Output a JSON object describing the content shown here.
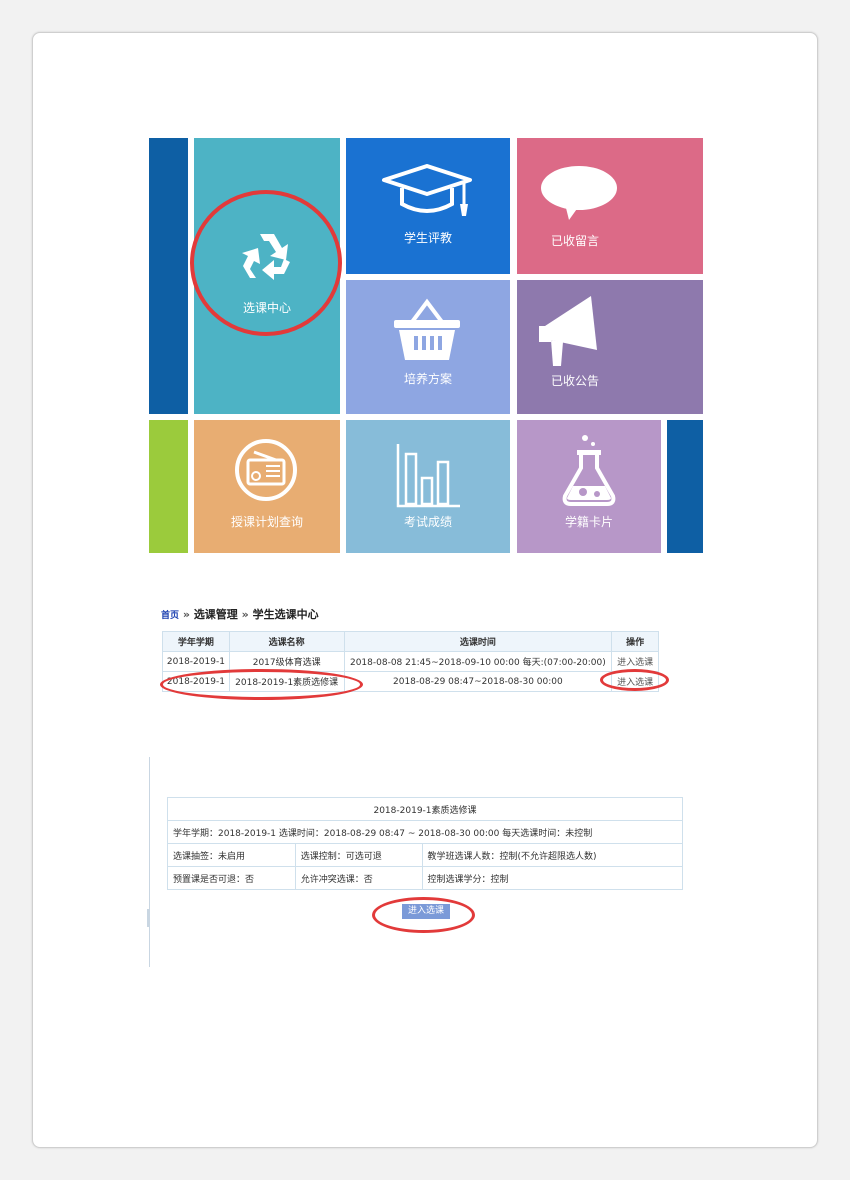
{
  "tiles": {
    "course_selection": "选课中心",
    "student_evaluation": "学生评教",
    "received_messages": "已收留言",
    "training_plan": "培养方案",
    "received_notices": "已收公告",
    "teaching_plan_query": "授课计划查询",
    "exam_scores": "考试成绩",
    "student_card": "学籍卡片"
  },
  "colors": {
    "dark_blue": "#0e5fa4",
    "teal": "#4db3c5",
    "blue": "#1a72d2",
    "pink": "#dc6a87",
    "periwinkle": "#8ea6e2",
    "purple": "#8e79ad",
    "green": "#9bcb3c",
    "orange": "#e8ad72",
    "light_blue": "#87bcd9",
    "lavender": "#b797c8",
    "annotation_red": "#e23a3a"
  },
  "breadcrumb": {
    "home": "首页",
    "separator": "»",
    "level1": "选课管理",
    "level2": "学生选课中心"
  },
  "course_table": {
    "headers": [
      "学年学期",
      "选课名称",
      "选课时间",
      "操作"
    ],
    "rows": [
      {
        "term": "2018-2019-1",
        "name": "2017级体育选课",
        "time": "2018-08-08 21:45~2018-09-10 00:00   每天:(07:00-20:00)",
        "action": "进入选课"
      },
      {
        "term": "2018-2019-1",
        "name": "2018-2019-1素质选修课",
        "time": "2018-08-29 08:47~2018-08-30 00:00",
        "action": "进入选课"
      }
    ]
  },
  "detail": {
    "title": "2018-2019-1素质选修课",
    "term_line": "学年学期：2018-2019-1      选课时间：2018-08-29 08:47 ~ 2018-08-30 00:00      每天选课时间：未控制",
    "r2c1": "选课抽签：未启用",
    "r2c2": "选课控制：可选可退",
    "r2c3": "教学班选课人数：控制(不允许超限选人数)",
    "r3c1": "预置课是否可退：否",
    "r3c2": "允许冲突选课：否",
    "r3c3": "控制选课学分：控制",
    "enter_button": "进入选课"
  }
}
